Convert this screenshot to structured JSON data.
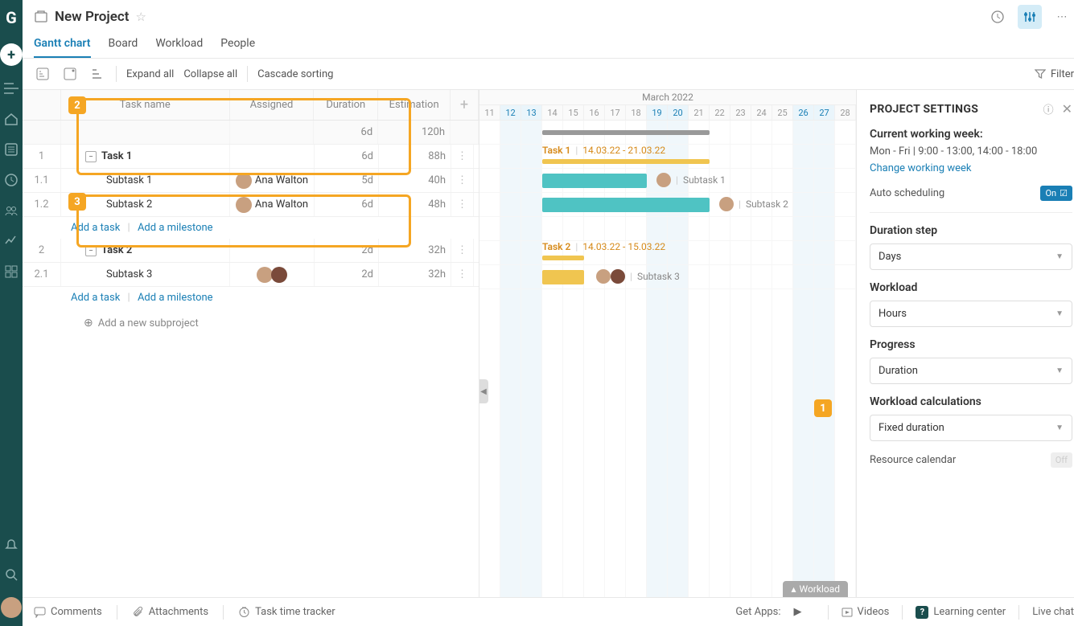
{
  "header": {
    "title": "New Project",
    "tabs": [
      "Gantt chart",
      "Board",
      "Workload",
      "People"
    ],
    "active_tab": 0
  },
  "toolbar": {
    "expand": "Expand all",
    "collapse": "Collapse all",
    "cascade": "Cascade sorting",
    "filter": "Filter"
  },
  "grid": {
    "columns": {
      "name": "Task name",
      "assigned": "Assigned",
      "duration": "Duration",
      "estimation": "Estimation"
    },
    "summary": {
      "duration": "6d",
      "estimation": "120h"
    },
    "rows": [
      {
        "num": "1",
        "name": "Task 1",
        "type": "parent",
        "duration": "6d",
        "est": "88h"
      },
      {
        "num": "1.1",
        "name": "Subtask 1",
        "assigned": "Ana Walton",
        "duration": "5d",
        "est": "40h"
      },
      {
        "num": "1.2",
        "name": "Subtask 2",
        "assigned": "Ana Walton",
        "duration": "6d",
        "est": "48h"
      },
      {
        "type": "add"
      },
      {
        "num": "2",
        "name": "Task 2",
        "type": "parent",
        "duration": "2d",
        "est": "32h"
      },
      {
        "num": "2.1",
        "name": "Subtask 3",
        "assigned_multi": true,
        "duration": "2d",
        "est": "32h"
      },
      {
        "type": "add"
      }
    ],
    "add_task": "Add a task",
    "add_milestone": "Add a milestone",
    "add_subproject": "Add a new subproject"
  },
  "timeline": {
    "month": "March 2022",
    "days": [
      {
        "n": "11"
      },
      {
        "n": "12",
        "w": true
      },
      {
        "n": "13",
        "w": true
      },
      {
        "n": "14"
      },
      {
        "n": "15"
      },
      {
        "n": "16"
      },
      {
        "n": "17"
      },
      {
        "n": "18"
      },
      {
        "n": "19",
        "w": true
      },
      {
        "n": "20",
        "w": true
      },
      {
        "n": "21"
      },
      {
        "n": "22"
      },
      {
        "n": "23"
      },
      {
        "n": "24"
      },
      {
        "n": "25"
      },
      {
        "n": "26",
        "w": true
      },
      {
        "n": "27",
        "w": true
      },
      {
        "n": "28"
      }
    ],
    "bars": {
      "task1_label": "Task 1",
      "task1_dates": "14.03.22 - 21.03.22",
      "subtask1_label": "Subtask 1",
      "subtask2_label": "Subtask 2",
      "task2_label": "Task 2",
      "task2_dates": "14.03.22 - 15.03.22",
      "subtask3_label": "Subtask 3"
    },
    "workload_tab": "Workload"
  },
  "settings": {
    "title": "PROJECT SETTINGS",
    "current_week_label": "Current working week:",
    "current_week": "Mon - Fri | 9:00 - 13:00,   14:00 - 18:00",
    "change_week": "Change working week",
    "auto_scheduling": "Auto scheduling",
    "auto_on": "On",
    "duration_step_label": "Duration step",
    "duration_step": "Days",
    "workload_label": "Workload",
    "workload": "Hours",
    "progress_label": "Progress",
    "progress": "Duration",
    "workload_calc_label": "Workload calculations",
    "workload_calc": "Fixed duration",
    "resource_calendar": "Resource calendar",
    "resource_off": "Off"
  },
  "footer": {
    "comments": "Comments",
    "attachments": "Attachments",
    "tracker": "Task time tracker",
    "get_apps": "Get Apps:",
    "videos": "Videos",
    "learning": "Learning center",
    "live_chat": "Live chat"
  },
  "callouts": {
    "one": "1",
    "two": "2",
    "three": "3"
  }
}
